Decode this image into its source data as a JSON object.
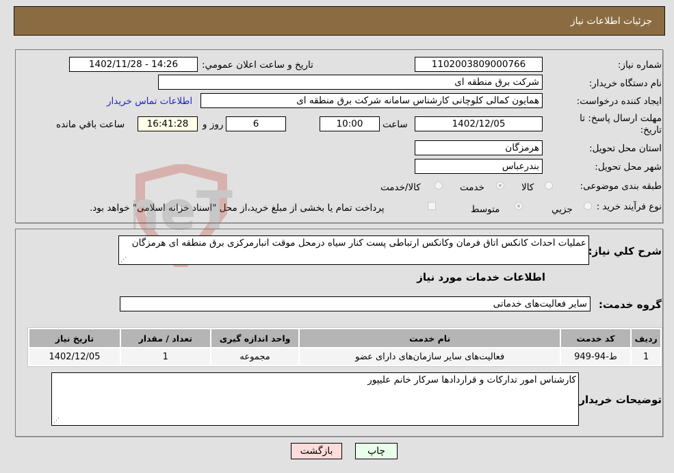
{
  "header": {
    "title": "جزئیات اطلاعات نیاز"
  },
  "form": {
    "need_number": {
      "label": "شماره نیاز:",
      "value": "1102003809000766"
    },
    "announce_datetime": {
      "label": "تاریخ و ساعت اعلان عمومي:",
      "value": "1402/11/28 - 14:26"
    },
    "buyer_org": {
      "label": "نام دستگاه خریدار:",
      "value": "شرکت برق منطقه ای"
    },
    "requester": {
      "label": "ایجاد کننده درخواست:",
      "value": "همایون کمالی کلوچانی کارشناس سامانه شرکت برق منطقه ای"
    },
    "buyer_contact_link": "اطلاعات تماس خریدار",
    "deadline": {
      "label": "مهلت ارسال پاسخ: تا تاریخ:",
      "date": "1402/12/05",
      "time_label": "ساعت",
      "time": "10:00",
      "days": "6",
      "days_label": "روز و",
      "remaining": "16:41:28",
      "remaining_label": "ساعت باقي مانده"
    },
    "province": {
      "label": "استان محل تحویل:",
      "value": "هرمزگان"
    },
    "city": {
      "label": "شهر محل تحویل:",
      "value": "بندرعباس"
    },
    "category": {
      "label": "طبقه بندی موضوعی:",
      "options": [
        "کالا",
        "خدمت",
        "کالا/خدمت"
      ],
      "selected": "خدمت"
    },
    "process": {
      "label": "نوع فرآیند خرید :",
      "options": [
        "جزيي",
        "متوسط"
      ],
      "selected": "متوسط",
      "treasury_note": "پرداخت تمام یا بخشی از مبلغ خرید،از محل \"اسناد خزانه اسلامی\" خواهد بود.",
      "treasury_checked": false
    }
  },
  "description": {
    "label": "شرح کلي نیاز:",
    "value": "عملیات احداث کانکس اتاق فرمان وکانکس ارتباطی پست کنار سیاه درمحل موقت انبارمرکزی برق منطقه ای هرمزگان"
  },
  "services": {
    "section_title": "اطلاعات خدمات مورد نیاز",
    "group_label": "گروه خدمت:",
    "group_value": "سایر فعالیت‌های خدماتی",
    "table": {
      "headers": [
        "ردیف",
        "کد خدمت",
        "نام خدمت",
        "واحد اندازه گیری",
        "تعداد / مقدار",
        "تاریخ نیاز"
      ],
      "rows": [
        [
          "1",
          "ط-94-949",
          "فعالیت‌های سایر سازمان‌های دارای عضو",
          "مجموعه",
          "1",
          "1402/12/05"
        ]
      ]
    }
  },
  "buyer_notes": {
    "label": "توضیحات خریدار:",
    "value": "کارشناس امور تدارکات و قراردادها سرکار خانم علیپور"
  },
  "buttons": {
    "print": "چاپ",
    "back": "بازگشت"
  },
  "watermark": {
    "text": "AriaTender.neT",
    "color": "#c0392b"
  }
}
